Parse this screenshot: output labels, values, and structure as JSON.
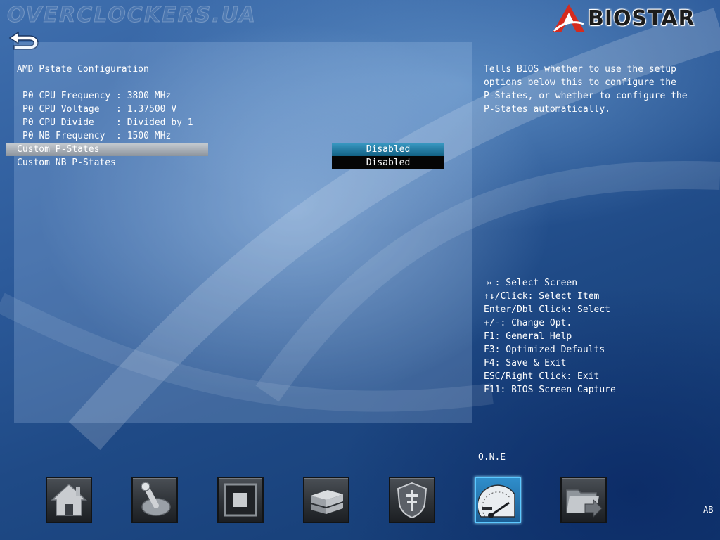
{
  "header": {
    "watermark": "OVERCLOCKERS.UA",
    "brand": "BIOSTAR",
    "back_icon": "back-arrow-icon"
  },
  "main": {
    "title": "AMD Pstate Configuration",
    "info_rows": [
      "P0 CPU Frequency : 3800 MHz",
      "P0 CPU Voltage   : 1.37500 V",
      "P0 CPU Divide    : Divided by 1",
      "P0 NB Frequency  : 1500 MHz"
    ],
    "options": [
      {
        "label": "Custom P-States",
        "value": "Disabled",
        "selected": true
      },
      {
        "label": "Custom NB P-States",
        "value": "Disabled",
        "selected": false
      }
    ]
  },
  "help": {
    "text": "Tells BIOS whether to use the setup\noptions below this to configure the\nP-States, or whether to configure the\nP-States automatically."
  },
  "keys": [
    "→←: Select Screen",
    "↑↓/Click: Select Item",
    "Enter/Dbl Click: Select",
    "+/-: Change Opt.",
    "F1: General Help",
    "F3: Optimized Defaults",
    "F4: Save & Exit",
    "ESC/Right Click: Exit",
    "F11: BIOS Screen Capture"
  ],
  "dock": {
    "active_label": "O.N.E",
    "corner_label": "AB",
    "items": [
      {
        "icon": "home-icon",
        "active": false
      },
      {
        "icon": "joystick-icon",
        "active": false
      },
      {
        "icon": "chip-icon",
        "active": false
      },
      {
        "icon": "drives-icon",
        "active": false
      },
      {
        "icon": "security-shield-icon",
        "active": false
      },
      {
        "icon": "speedometer-icon",
        "active": true
      },
      {
        "icon": "folder-exit-icon",
        "active": false
      }
    ]
  },
  "colors": {
    "accent": "#2f8ecb",
    "selected_value": "#126083",
    "brand_red": "#d52b1e"
  }
}
